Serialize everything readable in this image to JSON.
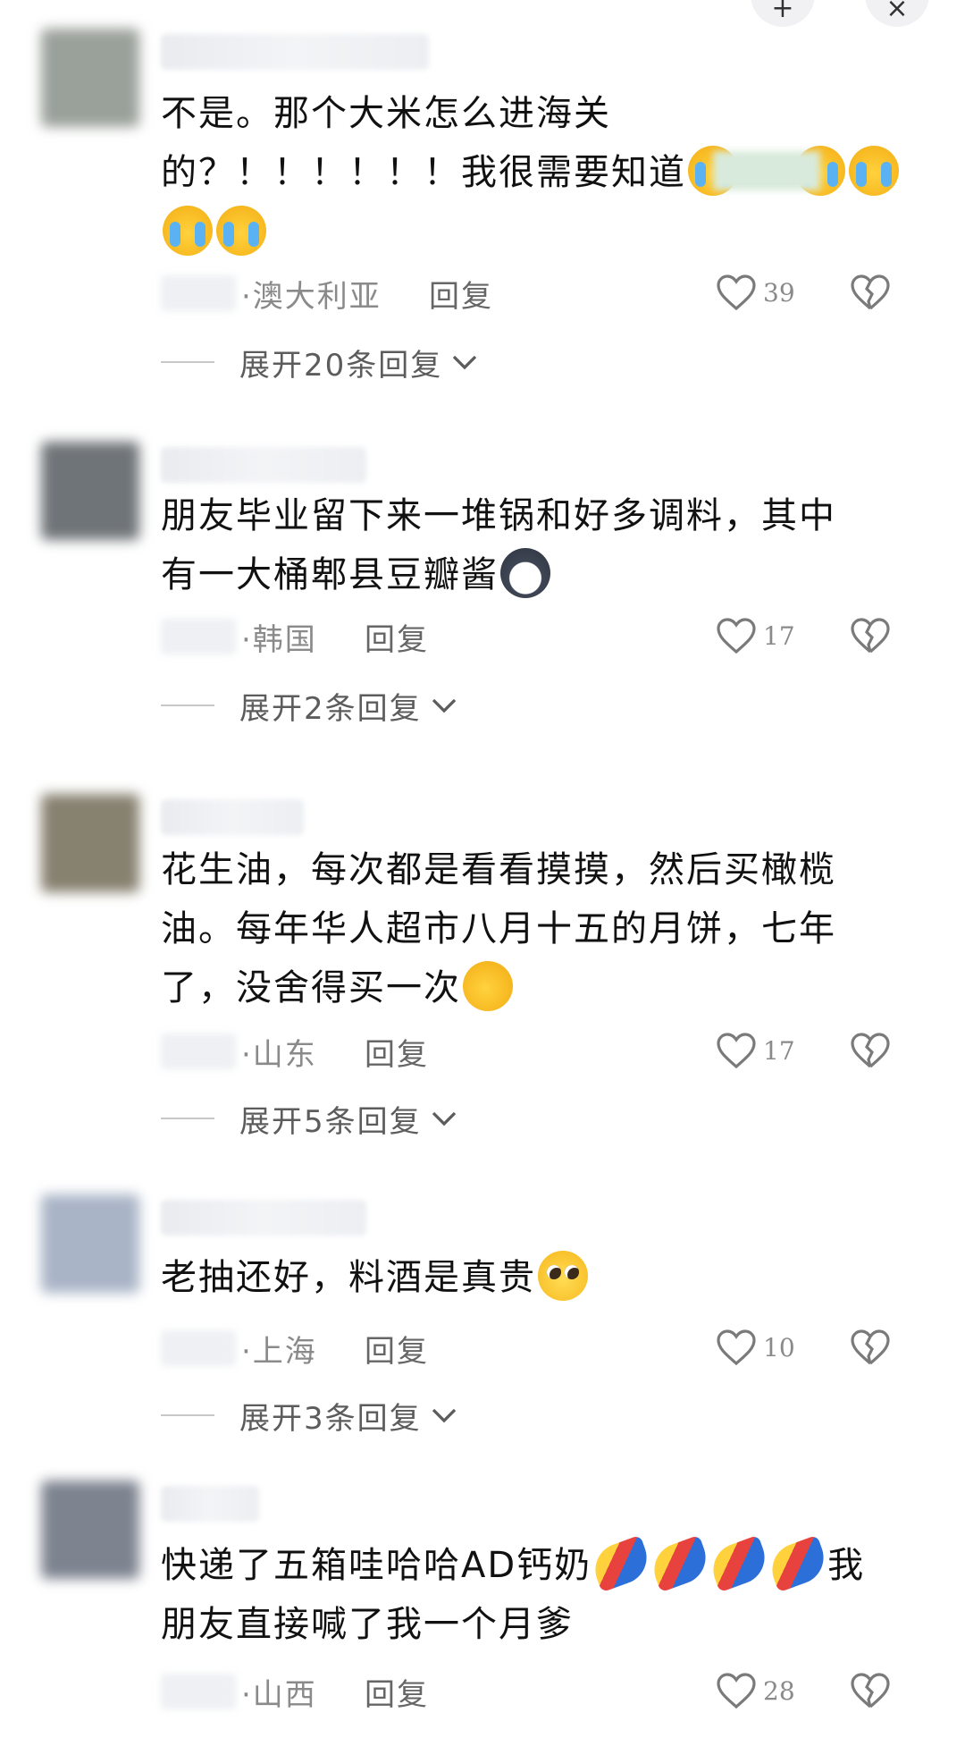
{
  "top_buttons": {
    "left_icon": "+",
    "right_icon": "×"
  },
  "comments": [
    {
      "text_lines": [
        "不是。那个大米怎么进海关",
        "的？！！！！！！我很需要知道"
      ],
      "location": "·澳大利亚",
      "reply": "回复",
      "likes": "39",
      "expand": "展开20条回复",
      "emoji": "cry-icon"
    },
    {
      "text_lines": [
        "朋友毕业留下来一堆锅和好多调料，其中",
        "有一大桶郫县豆瓣酱"
      ],
      "location": "·韩国",
      "reply": "回复",
      "likes": "17",
      "expand": "展开2条回复",
      "emoji": "dog-icon"
    },
    {
      "text_lines": [
        "花生油，每次都是看看摸摸，然后买橄榄",
        "油。每年华人超市八月十五的月饼，七年",
        "了，没舍得买一次"
      ],
      "location": "·山东",
      "reply": "回复",
      "likes": "17",
      "expand": "展开5条回复",
      "emoji": "facepalm-icon"
    },
    {
      "text_lines": [
        "老抽还好，料酒是真贵"
      ],
      "location": "·上海",
      "reply": "回复",
      "likes": "10",
      "expand": "展开3条回复",
      "emoji": "pleading-icon"
    },
    {
      "text_lines": [
        "快递了五箱哇哈哈AD钙奶",
        "我",
        "朋友直接喊了我一个月爹"
      ],
      "location": "·山西",
      "reply": "回复",
      "likes": "28",
      "emoji": "flying-doll-icon"
    }
  ],
  "colors": {
    "text": "#111111",
    "meta": "#8a8a8a",
    "reply": "#666666"
  }
}
